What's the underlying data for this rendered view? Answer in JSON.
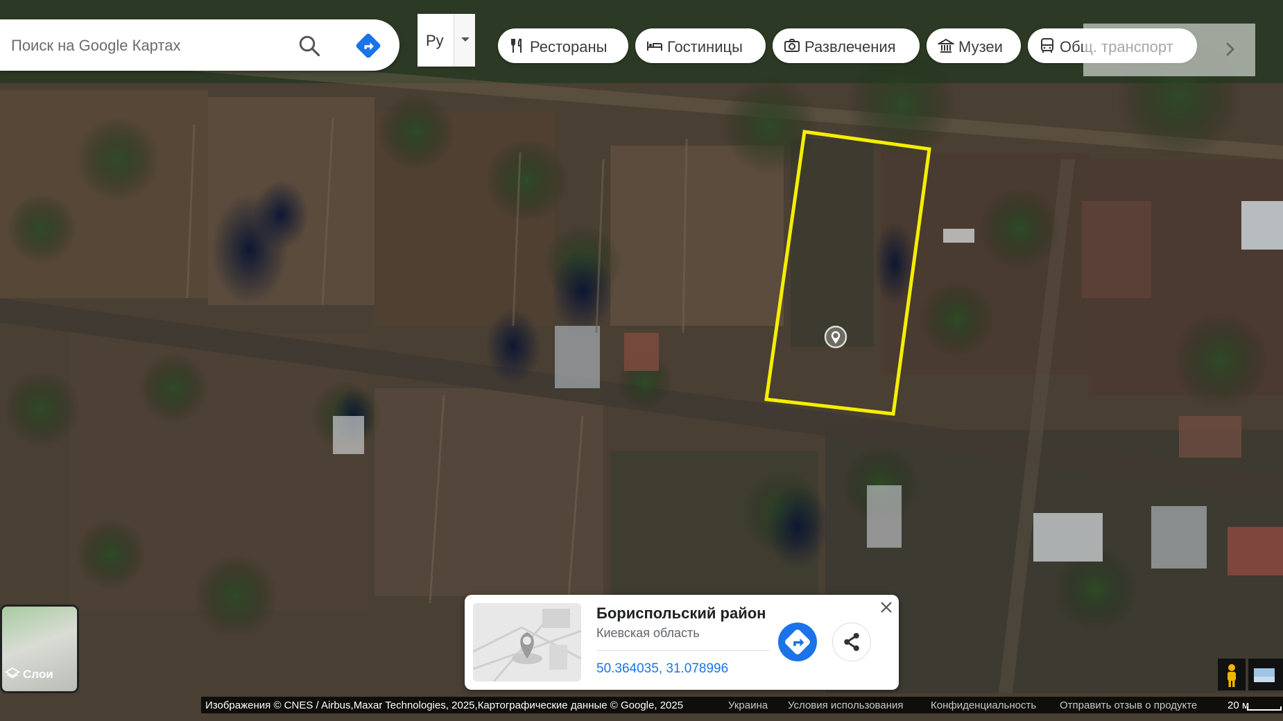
{
  "search": {
    "placeholder": "Поиск на Google Картах"
  },
  "language": {
    "label": "Ру"
  },
  "chips": [
    {
      "label": "Рестораны",
      "icon": "fork-knife-icon"
    },
    {
      "label": "Гостиницы",
      "icon": "bed-icon"
    },
    {
      "label": "Развлечения",
      "icon": "camera-icon"
    },
    {
      "label": "Музеи",
      "icon": "museum-icon"
    },
    {
      "label": "Общ. транспорт",
      "icon": "bus-icon"
    }
  ],
  "layers": {
    "label": "Слои"
  },
  "card": {
    "title": "Бориспольский район",
    "subtitle": "Киевская область",
    "coords": "50.364035, 31.078996"
  },
  "footer": {
    "imagery": "Изображения © CNES / Airbus,Maxar Technologies, 2025,Картографические данные © Google, 2025",
    "country": "Украина",
    "terms": "Условия использования",
    "privacy": "Конфиденциальность",
    "feedback": "Отправить отзыв о продукте",
    "scale": "20 м"
  },
  "colors": {
    "plot_outline": "#f5ee00",
    "accent_blue": "#1a73e8"
  }
}
